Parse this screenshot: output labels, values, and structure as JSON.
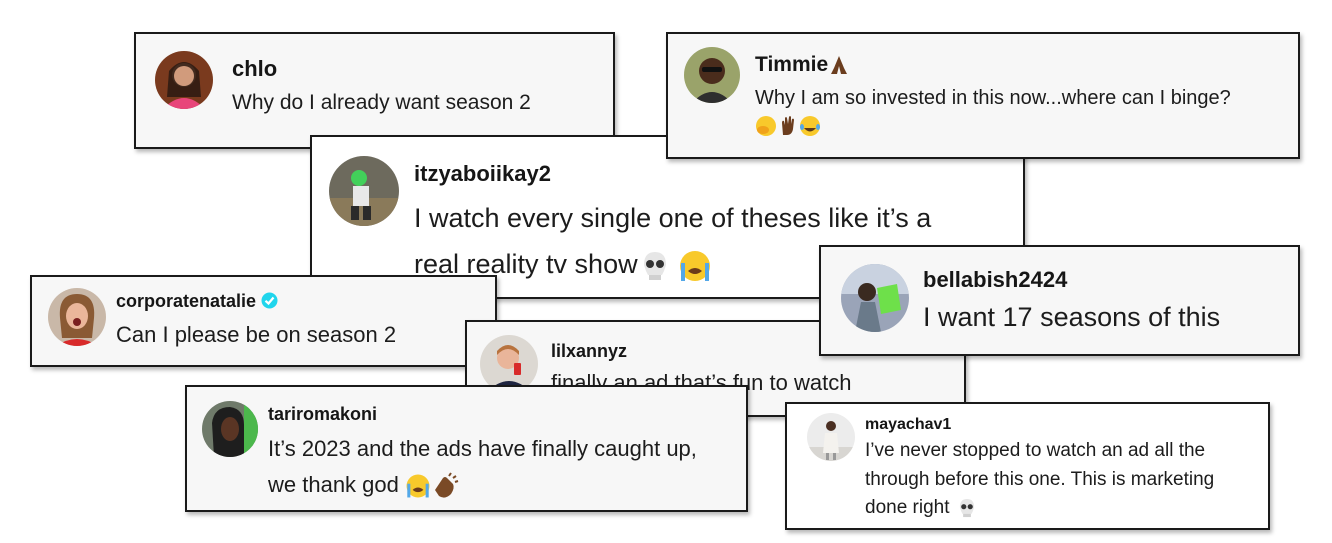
{
  "comments": [
    {
      "id": "chlo",
      "username": "chlo",
      "text_lines": [
        "Why do I already want season 2"
      ]
    },
    {
      "id": "timmie",
      "username": "Timmie",
      "username_emoji": "folded-hands-emoji",
      "text_lines": [
        "Why I am so invested in this now...where can I binge?"
      ],
      "emojis": [
        "hand-over-mouth-emoji",
        "raised-hand-emoji",
        "tears-of-joy-emoji"
      ]
    },
    {
      "id": "itzyaboiikay2",
      "username": "itzyaboiikay2",
      "text_lines": [
        "I watch every single one of theses like it’s a",
        "real reality tv show"
      ],
      "emojis": [
        "skull-emoji",
        "loudly-crying-emoji"
      ]
    },
    {
      "id": "corporatenatalie",
      "username": "corporatenatalie",
      "verified": true,
      "text_lines": [
        "Can I please be on season 2"
      ]
    },
    {
      "id": "bellabish2424",
      "username": "bellabish2424",
      "text_lines": [
        "I want 17 seasons of this"
      ]
    },
    {
      "id": "lilxannyz",
      "username": "lilxannyz",
      "text_lines": [
        "finally an ad that’s fun to watch"
      ]
    },
    {
      "id": "tariromakoni",
      "username": "tariromakoni",
      "text_lines": [
        "It’s 2023 and the ads have finally caught up,",
        "we thank god"
      ],
      "emojis": [
        "loudly-crying-emoji",
        "clapping-hands-emoji"
      ]
    },
    {
      "id": "mayachav1",
      "username": "mayachav1",
      "text_lines": [
        "I’ve never stopped to watch an ad all the",
        "through before this one. This is marketing",
        "done right"
      ],
      "emojis": [
        "skull-emoji"
      ]
    }
  ],
  "colors": {
    "card_bg": "#f7f7f7",
    "border": "#1a1a1a",
    "verified": "#20d5ec"
  }
}
